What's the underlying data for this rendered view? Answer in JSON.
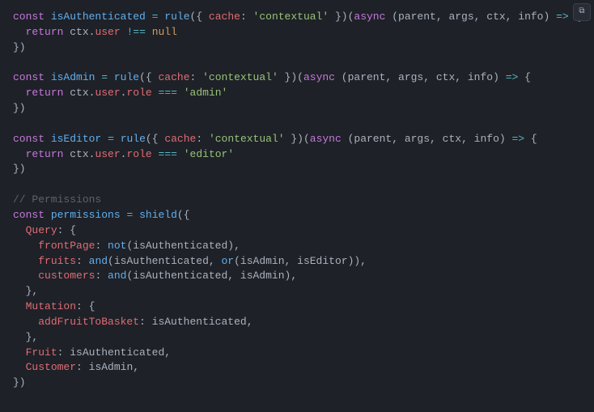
{
  "corner_icon": "⧉",
  "tokens": [
    [
      [
        "kw",
        "const"
      ],
      [
        "p",
        " "
      ],
      [
        "fn",
        "isAuthenticated"
      ],
      [
        "p",
        " "
      ],
      [
        "op",
        "="
      ],
      [
        "p",
        " "
      ],
      [
        "fn",
        "rule"
      ],
      [
        "p",
        "({ "
      ],
      [
        "prop",
        "cache"
      ],
      [
        "p",
        ": "
      ],
      [
        "str",
        "'contextual'"
      ],
      [
        "p",
        " })("
      ],
      [
        "kw",
        "async"
      ],
      [
        "p",
        " ("
      ],
      [
        "pn",
        "parent"
      ],
      [
        "p",
        ", "
      ],
      [
        "pn",
        "args"
      ],
      [
        "p",
        ", "
      ],
      [
        "pn",
        "ctx"
      ],
      [
        "p",
        ", "
      ],
      [
        "pn",
        "info"
      ],
      [
        "p",
        ") "
      ],
      [
        "op",
        "=>"
      ],
      [
        "p",
        " {"
      ]
    ],
    [
      [
        "p",
        "  "
      ],
      [
        "kw",
        "return"
      ],
      [
        "p",
        " "
      ],
      [
        "pn",
        "ctx"
      ],
      [
        "p",
        "."
      ],
      [
        "prop",
        "user"
      ],
      [
        "p",
        " "
      ],
      [
        "op",
        "!=="
      ],
      [
        "p",
        " "
      ],
      [
        "num",
        "null"
      ]
    ],
    [
      [
        "p",
        "})"
      ]
    ],
    [],
    [
      [
        "kw",
        "const"
      ],
      [
        "p",
        " "
      ],
      [
        "fn",
        "isAdmin"
      ],
      [
        "p",
        " "
      ],
      [
        "op",
        "="
      ],
      [
        "p",
        " "
      ],
      [
        "fn",
        "rule"
      ],
      [
        "p",
        "({ "
      ],
      [
        "prop",
        "cache"
      ],
      [
        "p",
        ": "
      ],
      [
        "str",
        "'contextual'"
      ],
      [
        "p",
        " })("
      ],
      [
        "kw",
        "async"
      ],
      [
        "p",
        " ("
      ],
      [
        "pn",
        "parent"
      ],
      [
        "p",
        ", "
      ],
      [
        "pn",
        "args"
      ],
      [
        "p",
        ", "
      ],
      [
        "pn",
        "ctx"
      ],
      [
        "p",
        ", "
      ],
      [
        "pn",
        "info"
      ],
      [
        "p",
        ") "
      ],
      [
        "op",
        "=>"
      ],
      [
        "p",
        " {"
      ]
    ],
    [
      [
        "p",
        "  "
      ],
      [
        "kw",
        "return"
      ],
      [
        "p",
        " "
      ],
      [
        "pn",
        "ctx"
      ],
      [
        "p",
        "."
      ],
      [
        "prop",
        "user"
      ],
      [
        "p",
        "."
      ],
      [
        "prop",
        "role"
      ],
      [
        "p",
        " "
      ],
      [
        "op",
        "==="
      ],
      [
        "p",
        " "
      ],
      [
        "str",
        "'admin'"
      ]
    ],
    [
      [
        "p",
        "})"
      ]
    ],
    [],
    [
      [
        "kw",
        "const"
      ],
      [
        "p",
        " "
      ],
      [
        "fn",
        "isEditor"
      ],
      [
        "p",
        " "
      ],
      [
        "op",
        "="
      ],
      [
        "p",
        " "
      ],
      [
        "fn",
        "rule"
      ],
      [
        "p",
        "({ "
      ],
      [
        "prop",
        "cache"
      ],
      [
        "p",
        ": "
      ],
      [
        "str",
        "'contextual'"
      ],
      [
        "p",
        " })("
      ],
      [
        "kw",
        "async"
      ],
      [
        "p",
        " ("
      ],
      [
        "pn",
        "parent"
      ],
      [
        "p",
        ", "
      ],
      [
        "pn",
        "args"
      ],
      [
        "p",
        ", "
      ],
      [
        "pn",
        "ctx"
      ],
      [
        "p",
        ", "
      ],
      [
        "pn",
        "info"
      ],
      [
        "p",
        ") "
      ],
      [
        "op",
        "=>"
      ],
      [
        "p",
        " {"
      ]
    ],
    [
      [
        "p",
        "  "
      ],
      [
        "kw",
        "return"
      ],
      [
        "p",
        " "
      ],
      [
        "pn",
        "ctx"
      ],
      [
        "p",
        "."
      ],
      [
        "prop",
        "user"
      ],
      [
        "p",
        "."
      ],
      [
        "prop",
        "role"
      ],
      [
        "p",
        " "
      ],
      [
        "op",
        "==="
      ],
      [
        "p",
        " "
      ],
      [
        "str",
        "'editor'"
      ]
    ],
    [
      [
        "p",
        "})"
      ]
    ],
    [],
    [
      [
        "cmt",
        "// Permissions"
      ]
    ],
    [
      [
        "kw",
        "const"
      ],
      [
        "p",
        " "
      ],
      [
        "fn",
        "permissions"
      ],
      [
        "p",
        " "
      ],
      [
        "op",
        "="
      ],
      [
        "p",
        " "
      ],
      [
        "fn",
        "shield"
      ],
      [
        "p",
        "({"
      ]
    ],
    [
      [
        "p",
        "  "
      ],
      [
        "prop",
        "Query"
      ],
      [
        "p",
        ": {"
      ]
    ],
    [
      [
        "p",
        "    "
      ],
      [
        "prop",
        "frontPage"
      ],
      [
        "p",
        ": "
      ],
      [
        "fn",
        "not"
      ],
      [
        "p",
        "("
      ],
      [
        "pn",
        "isAuthenticated"
      ],
      [
        "p",
        "),"
      ]
    ],
    [
      [
        "p",
        "    "
      ],
      [
        "prop",
        "fruits"
      ],
      [
        "p",
        ": "
      ],
      [
        "fn",
        "and"
      ],
      [
        "p",
        "("
      ],
      [
        "pn",
        "isAuthenticated"
      ],
      [
        "p",
        ", "
      ],
      [
        "fn",
        "or"
      ],
      [
        "p",
        "("
      ],
      [
        "pn",
        "isAdmin"
      ],
      [
        "p",
        ", "
      ],
      [
        "pn",
        "isEditor"
      ],
      [
        "p",
        ")),"
      ]
    ],
    [
      [
        "p",
        "    "
      ],
      [
        "prop",
        "customers"
      ],
      [
        "p",
        ": "
      ],
      [
        "fn",
        "and"
      ],
      [
        "p",
        "("
      ],
      [
        "pn",
        "isAuthenticated"
      ],
      [
        "p",
        ", "
      ],
      [
        "pn",
        "isAdmin"
      ],
      [
        "p",
        "),"
      ]
    ],
    [
      [
        "p",
        "  },"
      ]
    ],
    [
      [
        "p",
        "  "
      ],
      [
        "prop",
        "Mutation"
      ],
      [
        "p",
        ": {"
      ]
    ],
    [
      [
        "p",
        "    "
      ],
      [
        "prop",
        "addFruitToBasket"
      ],
      [
        "p",
        ": "
      ],
      [
        "pn",
        "isAuthenticated"
      ],
      [
        "p",
        ","
      ]
    ],
    [
      [
        "p",
        "  },"
      ]
    ],
    [
      [
        "p",
        "  "
      ],
      [
        "prop",
        "Fruit"
      ],
      [
        "p",
        ": "
      ],
      [
        "pn",
        "isAuthenticated"
      ],
      [
        "p",
        ","
      ]
    ],
    [
      [
        "p",
        "  "
      ],
      [
        "prop",
        "Customer"
      ],
      [
        "p",
        ": "
      ],
      [
        "pn",
        "isAdmin"
      ],
      [
        "p",
        ","
      ]
    ],
    [
      [
        "p",
        "})"
      ]
    ]
  ]
}
